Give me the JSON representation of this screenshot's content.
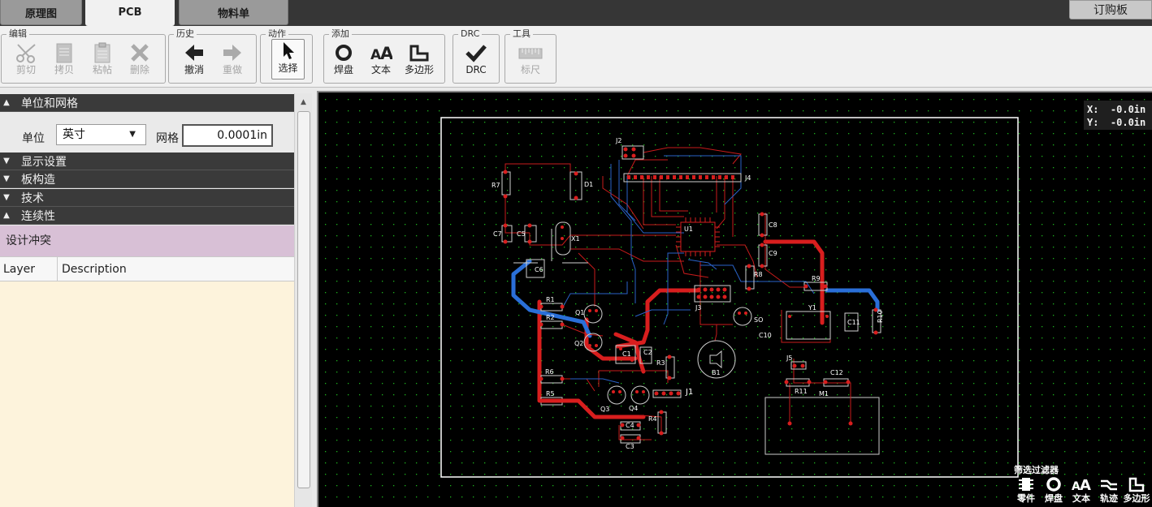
{
  "tabs": [
    {
      "label": "原理图"
    },
    {
      "label": "PCB"
    },
    {
      "label": "物料单"
    }
  ],
  "order_button": "订购板",
  "toolbar": {
    "groups": {
      "edit": "编辑",
      "history": "历史",
      "action": "动作",
      "add": "添加",
      "drc": "DRC",
      "tools": "工具"
    },
    "cut": "剪切",
    "copy": "拷贝",
    "paste": "粘帖",
    "delete": "删除",
    "undo": "撤消",
    "redo": "重做",
    "select": "选择",
    "pad": "焊盘",
    "text": "文本",
    "polygon": "多边形",
    "drc": "DRC",
    "ruler": "标尺"
  },
  "panel": {
    "units_section": "单位和网格",
    "unit_label": "单位",
    "unit_value": "英寸",
    "grid_label": "网格",
    "grid_value": "0.0001in",
    "display_section": "显示设置",
    "board_section": "板构造",
    "tech_section": "技术",
    "connectivity_section": "连续性",
    "conflicts_label": "设计冲突",
    "table_headers": [
      "Layer",
      "Description"
    ],
    "table_rows": []
  },
  "canvas": {
    "coords": {
      "x_line": "X:  -0.0in",
      "y_line": "Y:  -0.0in"
    },
    "filter_title": "筛选过滤器",
    "filter_buttons": [
      "零件",
      "焊盘",
      "文本",
      "轨迹",
      "多边形"
    ],
    "designators": [
      "J2",
      "J4",
      "R7",
      "D1",
      "C7",
      "C5",
      "X1",
      "U1",
      "C8",
      "C9",
      "C6",
      "R8",
      "R9",
      "R1",
      "R2",
      "Q1",
      "J3",
      "Y1",
      "C11",
      "R10",
      "SO",
      "C10",
      "Q2",
      "C1",
      "C2",
      "R3",
      "B1",
      "J5",
      "R6",
      "C12",
      "R11",
      "M1",
      "R5",
      "Q3",
      "Q4",
      "J1",
      "R4",
      "C4",
      "C3"
    ]
  },
  "colors": {
    "top_copper": "#d81e1e",
    "bottom_copper": "#2a6fd8",
    "grid_dot": "#1db21d",
    "silkscreen": "#ffffff"
  }
}
